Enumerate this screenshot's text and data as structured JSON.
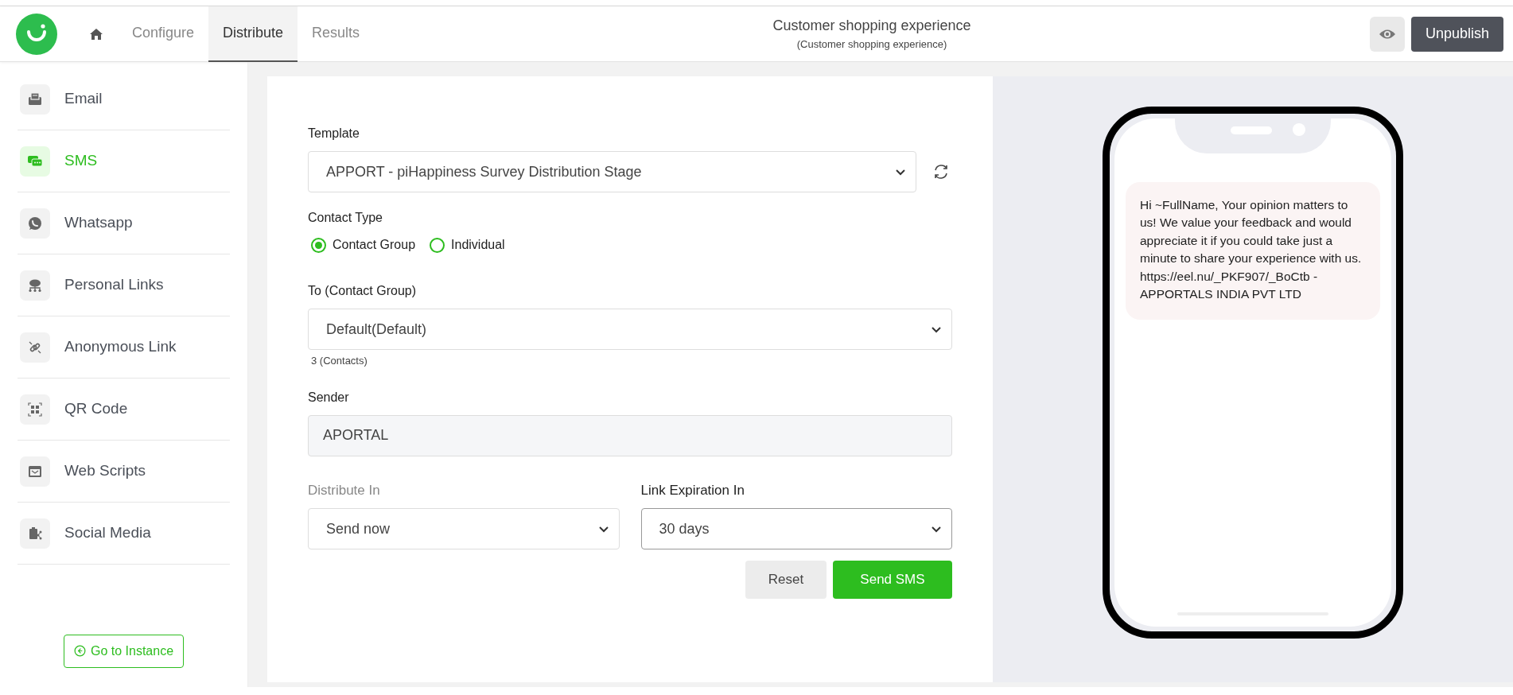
{
  "header": {
    "nav": [
      {
        "kind": "home",
        "selected": false
      },
      {
        "kind": "tab",
        "label": "Configure",
        "selected": false
      },
      {
        "kind": "tab",
        "label": "Distribute",
        "selected": true
      },
      {
        "kind": "tab",
        "label": "Results",
        "selected": false
      }
    ],
    "title": "Customer shopping experience",
    "subtitle": "(Customer shopping experience)",
    "unpublish": "Unpublish"
  },
  "sidebar": {
    "items": [
      {
        "kind": "email",
        "label": "Email",
        "selected": false
      },
      {
        "kind": "sms",
        "label": "SMS",
        "selected": true
      },
      {
        "kind": "whatsapp",
        "label": "Whatsapp",
        "selected": false
      },
      {
        "kind": "personal",
        "label": "Personal Links",
        "selected": false
      },
      {
        "kind": "anonymous",
        "label": "Anonymous Link",
        "selected": false
      },
      {
        "kind": "qr",
        "label": "QR Code",
        "selected": false
      },
      {
        "kind": "web",
        "label": "Web Scripts",
        "selected": false
      },
      {
        "kind": "social",
        "label": "Social Media",
        "selected": false
      }
    ],
    "go_to_instance": "Go to Instance"
  },
  "form": {
    "template": {
      "label": "Template",
      "value": "APPORT - piHappiness Survey Distribution Stage"
    },
    "contact_type": {
      "label": "Contact Type",
      "options": [
        {
          "label": "Contact Group",
          "selected": true
        },
        {
          "label": "Individual",
          "selected": false
        }
      ]
    },
    "to": {
      "label": "To (Contact Group)",
      "value": "Default(Default)",
      "note": "3 (Contacts)"
    },
    "sender": {
      "label": "Sender",
      "value": "APORTAL"
    },
    "distribute_in": {
      "label": "Distribute In",
      "value": "Send now"
    },
    "link_expiration": {
      "label": "Link Expiration In",
      "value": "30 days"
    },
    "buttons": {
      "reset": "Reset",
      "send": "Send SMS"
    }
  },
  "preview": {
    "message": "Hi ~FullName, Your opinion matters to us! We value your feedback and would appreciate it if you could take just a minute to share your experience with us. https://eel.nu/_PKF907/_BoCtb - APPORTALS INDIA PVT LTD"
  }
}
